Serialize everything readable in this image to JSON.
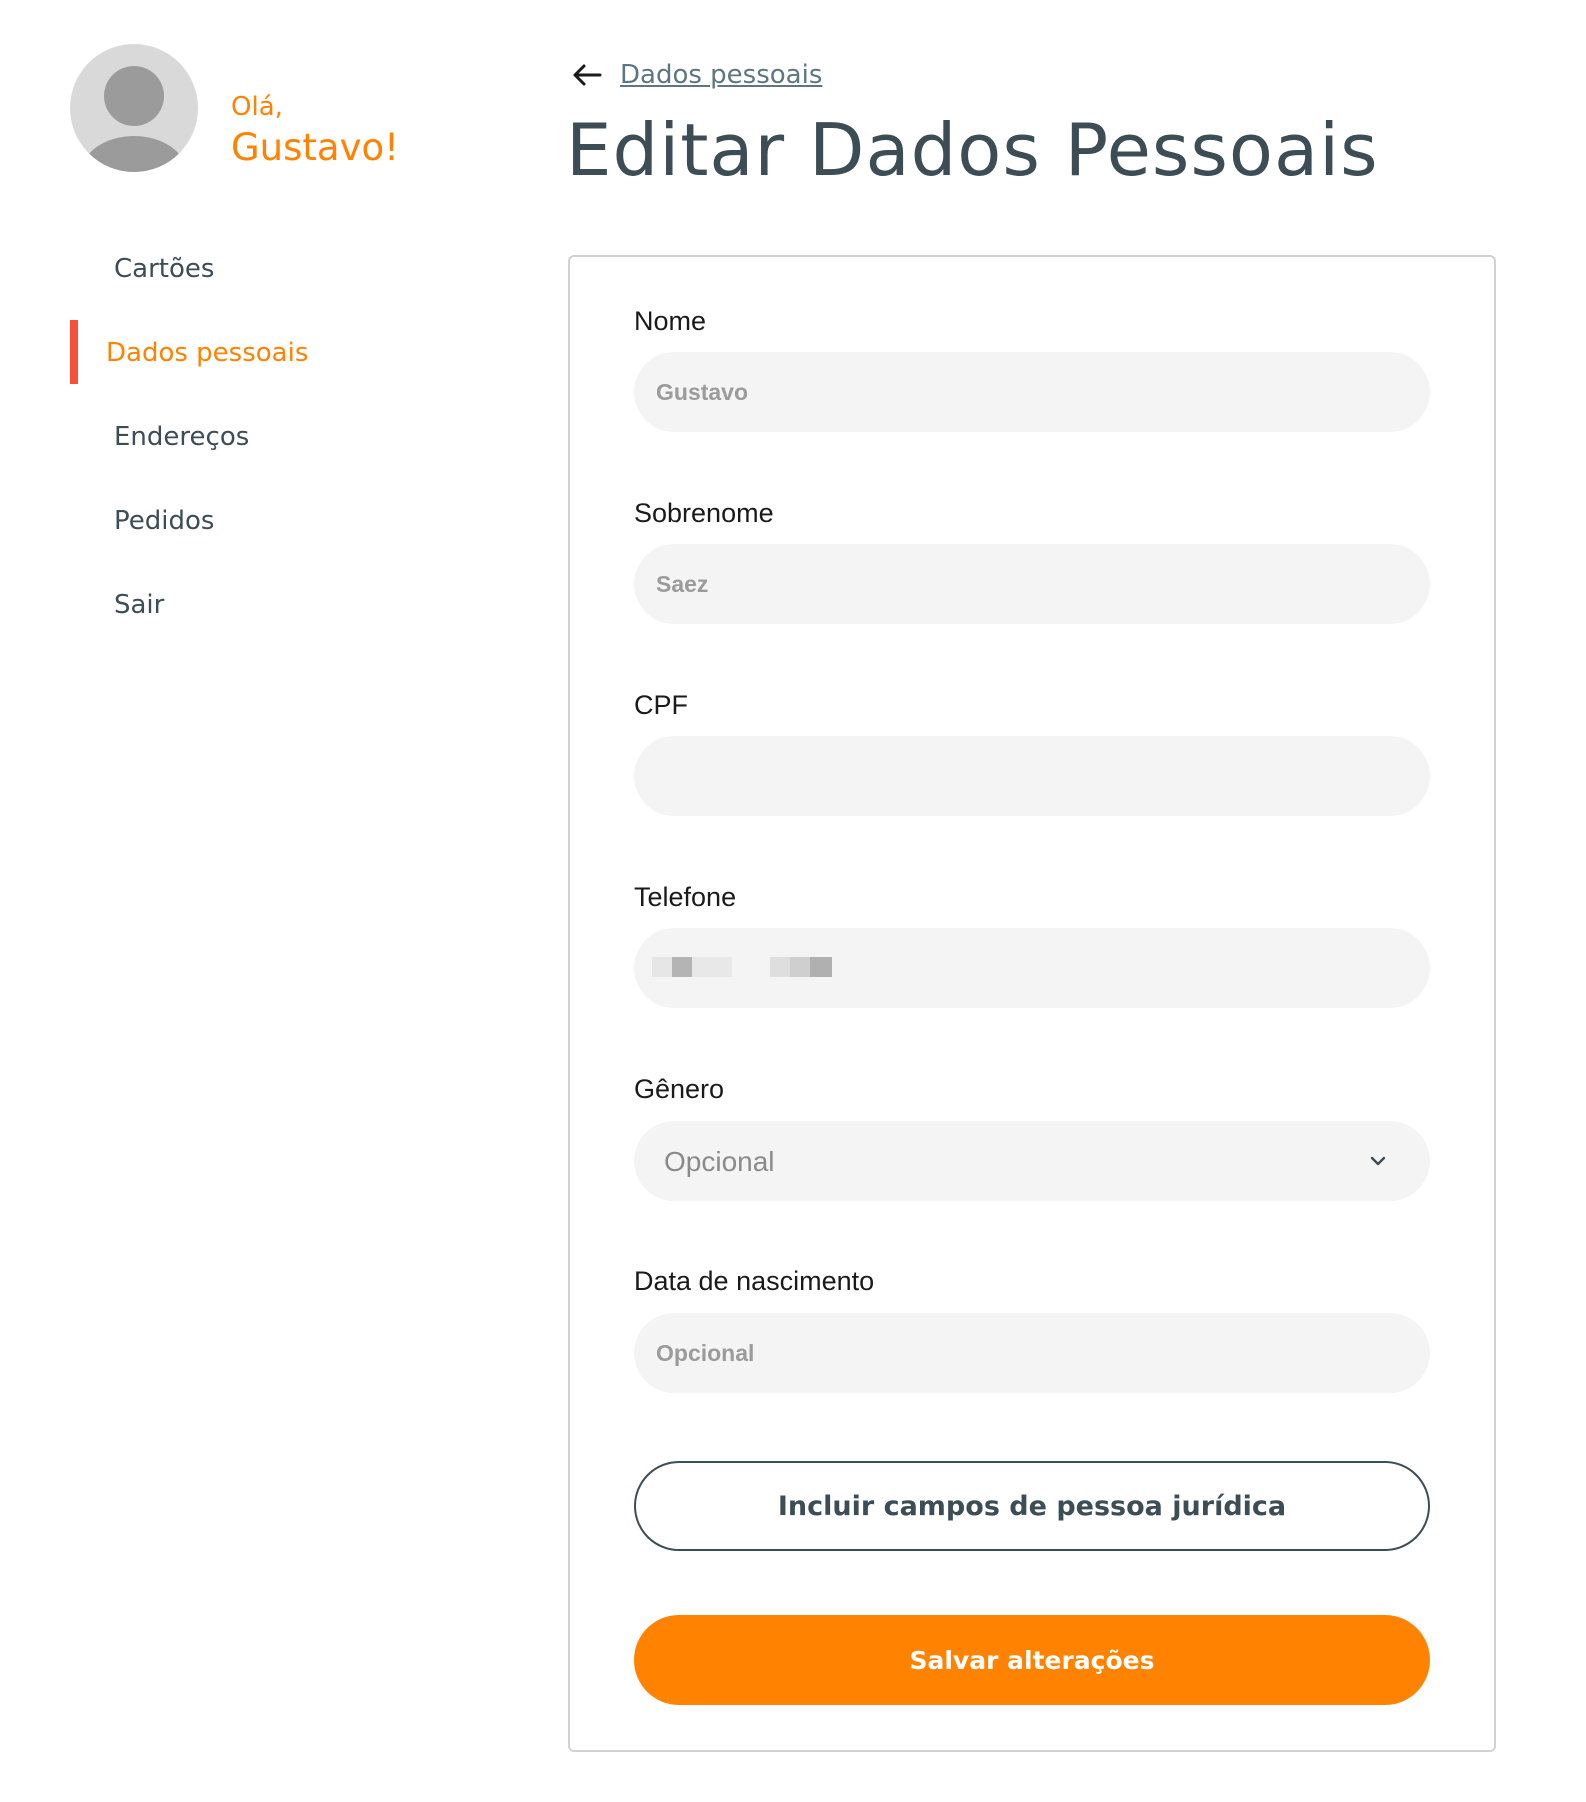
{
  "user": {
    "greeting": "Olá,",
    "name": "Gustavo!"
  },
  "sidebar": {
    "items": [
      {
        "label": "Cartões",
        "active": false
      },
      {
        "label": "Dados pessoais",
        "active": true
      },
      {
        "label": "Endereços",
        "active": false
      },
      {
        "label": "Pedidos",
        "active": false
      },
      {
        "label": "Sair",
        "active": false
      }
    ]
  },
  "header": {
    "breadcrumb": "Dados pessoais",
    "title": "Editar Dados Pessoais"
  },
  "form": {
    "nome": {
      "label": "Nome",
      "value": "Gustavo"
    },
    "sobrenome": {
      "label": "Sobrenome",
      "value": "Saez"
    },
    "cpf": {
      "label": "CPF",
      "value": ""
    },
    "telefone": {
      "label": "Telefone",
      "value": ""
    },
    "genero": {
      "label": "Gênero",
      "selected": "Opcional"
    },
    "nascimento": {
      "label": "Data de nascimento",
      "placeholder": "Opcional"
    },
    "juridica_button": "Incluir campos de pessoa jurídica",
    "save_button": "Salvar alterações"
  },
  "colors": {
    "accent": "#ff8200",
    "active_bar": "#f7513b",
    "text_dark": "#3d4d55",
    "field_bg": "#f4f4f4"
  }
}
